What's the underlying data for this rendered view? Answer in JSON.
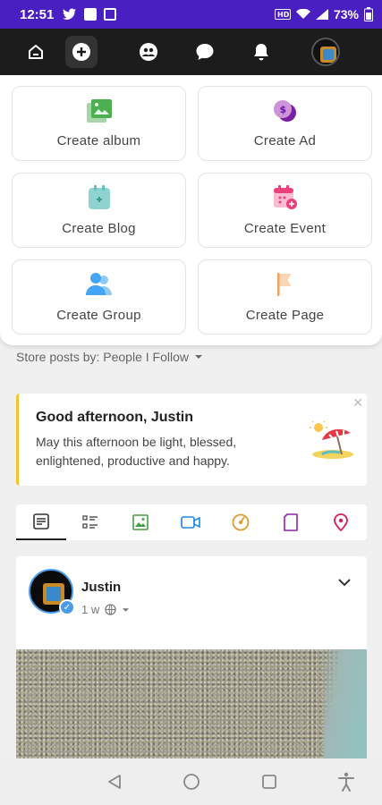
{
  "status_bar": {
    "time": "12:51",
    "battery": "73%"
  },
  "create_menu": {
    "items": [
      {
        "label": "Create album",
        "icon": "album-icon",
        "color": "#4caf50"
      },
      {
        "label": "Create Ad",
        "icon": "ad-icon",
        "color": "#9c27b0"
      },
      {
        "label": "Create Blog",
        "icon": "blog-icon",
        "color": "#5bc0be"
      },
      {
        "label": "Create Event",
        "icon": "event-icon",
        "color": "#ec407a"
      },
      {
        "label": "Create Group",
        "icon": "group-icon",
        "color": "#42a5f5"
      },
      {
        "label": "Create Page",
        "icon": "page-flag-icon",
        "color": "#f4a261"
      }
    ]
  },
  "feed": {
    "store_by_label": "Store posts by: People I Follow"
  },
  "greeting": {
    "title": "Good afternoon, Justin",
    "message": "May this afternoon be light, blessed, enlightened, productive and happy.",
    "close": "✕"
  },
  "post": {
    "author": "Justin",
    "time": "1 w"
  },
  "colors": {
    "status_bar": "#4a1fc2",
    "top_nav": "#1c1c1c",
    "greeting_accent": "#f4c430"
  }
}
